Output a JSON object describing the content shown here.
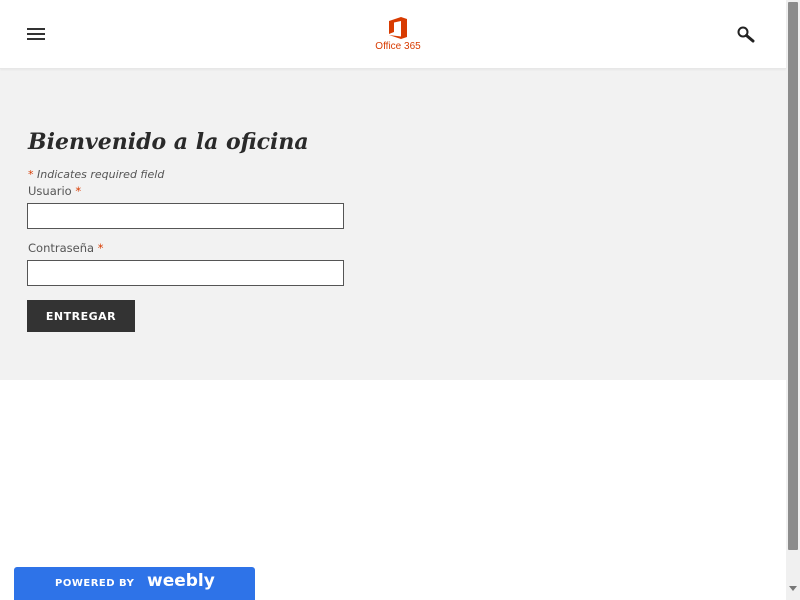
{
  "header": {
    "logo_text": "Office 365",
    "brand_color": "#d83b01"
  },
  "main": {
    "title": "Bienvenido a la oficina",
    "required_note": "Indicates required field",
    "required_marker": "*",
    "username_label": "Usuario",
    "password_label": "Contraseña",
    "username_value": "",
    "password_value": "",
    "submit_label": "ENTREGAR"
  },
  "footer": {
    "powered_by": "POWERED BY",
    "weebly": "weebly",
    "badge_color": "#2e73e8"
  },
  "icons": {
    "menu": "hamburger-menu-icon",
    "search": "search-icon",
    "logo": "office-logo-icon"
  }
}
